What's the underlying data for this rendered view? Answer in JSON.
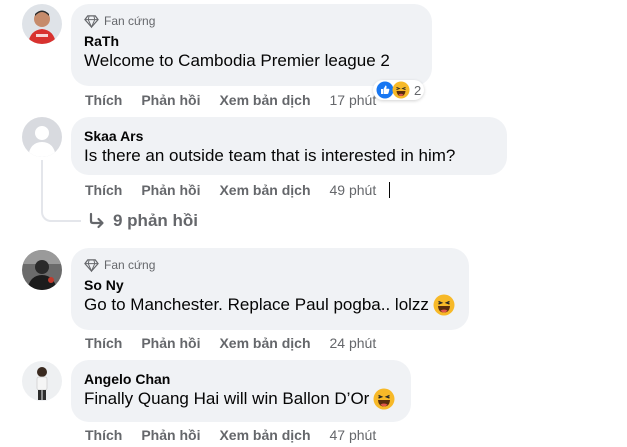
{
  "comments": [
    {
      "badge": "Fan cứng",
      "author": "RaTh",
      "text": "Welcome to Cambodia Premier league 2",
      "like": "Thích",
      "reply": "Phản hồi",
      "translate": "Xem bản dịch",
      "time": "17 phút",
      "reaction_count": "2",
      "reaction_icons": [
        "like-reaction-icon",
        "haha-reaction-icon"
      ]
    },
    {
      "badge": "",
      "author": "Skaa Ars",
      "text": "Is there an outside team that is interested in him?",
      "like": "Thích",
      "reply": "Phản hồi",
      "translate": "Xem bản dịch",
      "time": "49 phút",
      "replies_label": "9 phản hồi"
    },
    {
      "badge": "Fan cứng",
      "author": "So Ny",
      "text": "Go to Manchester. Replace Paul pogba.. lolzz",
      "like": "Thích",
      "reply": "Phản hồi",
      "translate": "Xem bản dịch",
      "time": "24 phút",
      "emoji": "laughing-emoji-icon"
    },
    {
      "badge": "",
      "author": "Angelo Chan",
      "text": "Finally Quang Hai will win Ballon D’Or",
      "like": "Thích",
      "reply": "Phản hồi",
      "translate": "Xem bản dịch",
      "time": "47 phút",
      "emoji": "laughing-emoji-icon"
    }
  ],
  "colors": {
    "bubble": "#f0f2f5",
    "secondary_text": "#65676b",
    "primary_text": "#050505",
    "like_blue": "#1877f2",
    "emoji_yellow": "#f7b928"
  }
}
